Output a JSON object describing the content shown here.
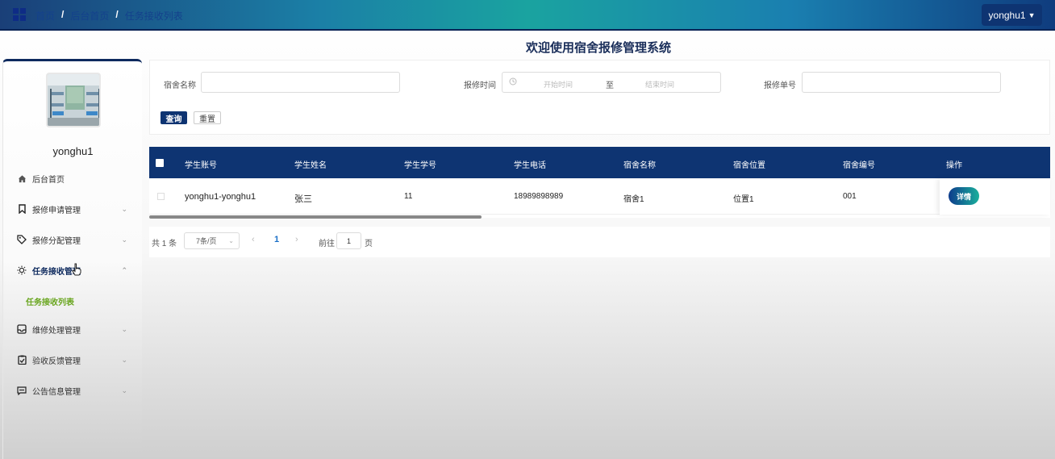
{
  "header": {
    "breadcrumb": [
      "首页",
      "后台首页",
      "任务接收列表"
    ],
    "separator": "/",
    "user_button": "yonghu1",
    "user_caret_icon": "chevron-down-icon"
  },
  "title": "欢迎使用宿舍报修管理系统",
  "sidebar": {
    "username": "yonghu1",
    "items": [
      {
        "label": "后台首页",
        "icon": "home-icon",
        "chev": ""
      },
      {
        "label": "报修申请管理",
        "icon": "bookmark-icon",
        "chev": "⌄"
      },
      {
        "label": "报修分配管理",
        "icon": "tag-icon",
        "chev": "⌄"
      },
      {
        "label": "任务接收管理",
        "icon": "sun-icon",
        "chev": "⌃"
      },
      {
        "label": "维修处理管理",
        "icon": "inbox-icon",
        "chev": "⌄"
      },
      {
        "label": "验收反馈管理",
        "icon": "clipboard-check-icon",
        "chev": "⌄"
      },
      {
        "label": "公告信息管理",
        "icon": "message-icon",
        "chev": "⌄"
      }
    ],
    "sub_item": "任务接收列表"
  },
  "search": {
    "dorm_name_label": "宿舍名称",
    "dorm_name_value": "",
    "repair_time_label": "报修时间",
    "start_placeholder": "开始时间",
    "range_separator": "至",
    "end_placeholder": "结束时间",
    "repair_no_label": "报修单号",
    "repair_no_value": "",
    "query_button": "查询",
    "reset_button": "重置"
  },
  "table": {
    "columns": [
      "学生账号",
      "学生姓名",
      "学生学号",
      "学生电话",
      "宿舍名称",
      "宿舍位置",
      "宿舍编号",
      "操作"
    ],
    "rows": [
      {
        "account": "yonghu1-yonghu1",
        "name": "张三",
        "student_no": "11",
        "phone": "18989898989",
        "dorm_name": "宿舍1",
        "dorm_location": "位置1",
        "dorm_no": "001",
        "action": "详情"
      }
    ]
  },
  "pagination": {
    "total": "共 1 条",
    "page_size": "7条/页",
    "prev": "‹",
    "current": "1",
    "next": "›",
    "goto_label": "前往",
    "goto_value": "1",
    "page_suffix": "页"
  },
  "colors": {
    "primary": "#0e3472",
    "accent_green": "#6aa620",
    "link_blue": "#1a6fc7"
  }
}
